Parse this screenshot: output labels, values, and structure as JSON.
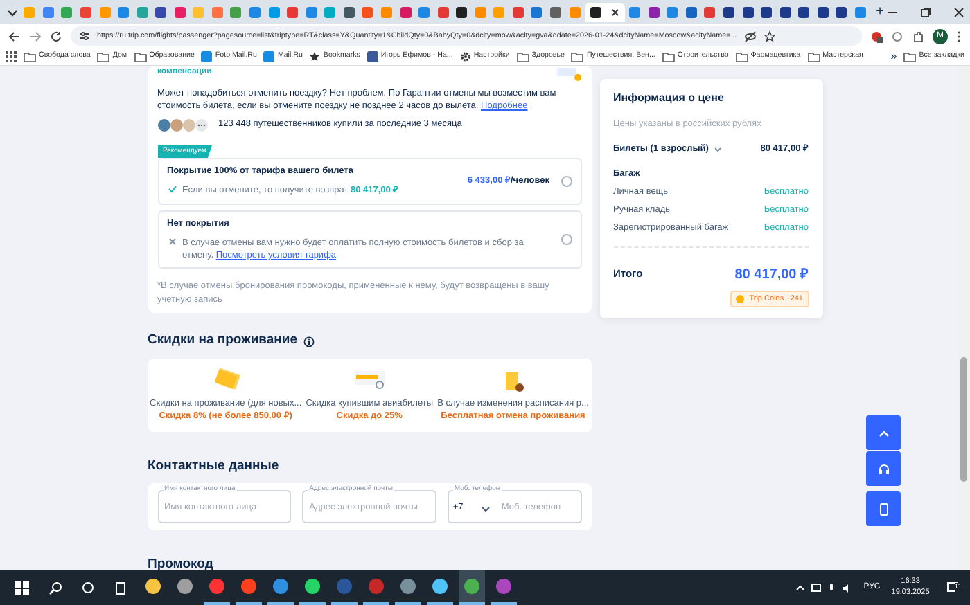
{
  "browser": {
    "tabs": [
      {
        "color": "#f9ab00",
        "selected": false
      },
      {
        "color": "#4285f4",
        "selected": false
      },
      {
        "color": "#34a853",
        "selected": false
      },
      {
        "color": "#ea4335",
        "selected": false
      },
      {
        "color": "#ff9800",
        "selected": false
      },
      {
        "color": "#1e88e5",
        "selected": false
      },
      {
        "color": "#26a69a",
        "selected": false
      },
      {
        "color": "#3949ab",
        "selected": false
      },
      {
        "color": "#e91e63",
        "selected": false
      },
      {
        "color": "#fbc02d",
        "selected": false
      },
      {
        "color": "#ff7043",
        "selected": false
      },
      {
        "color": "#43a047",
        "selected": false
      },
      {
        "color": "#1e88e5",
        "selected": false
      },
      {
        "color": "#039be5",
        "selected": false
      },
      {
        "color": "#e53935",
        "selected": false
      },
      {
        "color": "#1e88e5",
        "selected": false
      },
      {
        "color": "#00acc1",
        "selected": false
      },
      {
        "color": "#455a64",
        "selected": false
      },
      {
        "color": "#f4511e",
        "selected": false
      },
      {
        "color": "#fb8c00",
        "selected": false
      },
      {
        "color": "#d81b60",
        "selected": false
      },
      {
        "color": "#1e88e5",
        "selected": false
      },
      {
        "color": "#e53935",
        "selected": false
      },
      {
        "color": "#212121",
        "selected": false
      },
      {
        "color": "#fb8c00",
        "selected": false
      },
      {
        "color": "#ffa000",
        "selected": false
      },
      {
        "color": "#e53935",
        "selected": false
      },
      {
        "color": "#1976d2",
        "selected": false
      },
      {
        "color": "#616161",
        "selected": false
      },
      {
        "color": "#fb8c00",
        "selected": false
      },
      {
        "color": "#212121",
        "selected": true
      },
      {
        "color": "#1e88e5",
        "selected": false
      },
      {
        "color": "#8e24aa",
        "selected": false
      },
      {
        "color": "#1e88e5",
        "selected": false
      },
      {
        "color": "#1565c0",
        "selected": false
      },
      {
        "color": "#e53935",
        "selected": false
      },
      {
        "color": "#1e3a8a",
        "selected": false
      },
      {
        "color": "#1e3a8a",
        "selected": false
      },
      {
        "color": "#1e3a8a",
        "selected": false
      },
      {
        "color": "#1e3a8a",
        "selected": false
      },
      {
        "color": "#1e3a8a",
        "selected": false
      },
      {
        "color": "#1e3a8a",
        "selected": false
      },
      {
        "color": "#1e3a8a",
        "selected": false
      },
      {
        "color": "#1e88e5",
        "selected": false
      }
    ],
    "new_tab": "+",
    "url": "https://ru.trip.com/flights/passenger?pagesource=list&triptype=RT&class=Y&Quantity=1&ChildQty=0&BabyQty=0&dcity=mow&acity=gva&ddate=2026-01-24&dcityName=Moscow&acityName=...",
    "profile": "M",
    "bookmarks": [
      {
        "kind": "folder",
        "label": "Свобода слова"
      },
      {
        "kind": "folder",
        "label": "Дом"
      },
      {
        "kind": "folder",
        "label": "Образование"
      },
      {
        "kind": "site",
        "label": "Foto.Mail.Ru",
        "color": "#168de2"
      },
      {
        "kind": "site",
        "label": "Mail.Ru",
        "color": "#168de2"
      },
      {
        "kind": "star",
        "label": "Bookmarks"
      },
      {
        "kind": "site",
        "label": "Игорь Ефимов - На...",
        "color": "#3b5998"
      },
      {
        "kind": "gear",
        "label": "Настройки"
      },
      {
        "kind": "folder",
        "label": "Здоровье"
      },
      {
        "kind": "folder",
        "label": "Путешествия. Вен..."
      },
      {
        "kind": "folder",
        "label": "Строительство"
      },
      {
        "kind": "folder",
        "label": "Фармацевтика"
      },
      {
        "kind": "folder",
        "label": "Мастерская"
      }
    ],
    "bookmarks_overflow": "»",
    "all_bookmarks": "Все закладки"
  },
  "insurance": {
    "section_label": "компенсации",
    "description": "Может понадобиться отменить поездку? Нет проблем. По Гарантии отмены мы возместим вам стоимость билета, если вы отмените поездку не позднее 2 часов до вылета.",
    "more_link": "Подробнее",
    "travelers": "123 448 путешественников купили за последние 3 месяца",
    "options": [
      {
        "badge": "Рекомендуем",
        "title": "Покрытие 100% от тарифа вашего билета",
        "price": "6 433,00 ₽",
        "price_unit": "/человек",
        "kind": "covered",
        "note": "Если вы отмените, то получите возврат",
        "refund": "80 417,00 ₽",
        "selected": false
      },
      {
        "title": "Нет покрытия",
        "kind": "uncovered",
        "note": "В случае отмены вам нужно будет оплатить полную стоимость билетов и сбор за отмену.",
        "link": "Посмотреть условия тарифа",
        "selected": false
      }
    ],
    "footnote": "*В случае отмены бронирования промокоды, примененные к нему, будут возвращены в вашу учетную запись"
  },
  "price_info": {
    "title": "Информация о цене",
    "subtitle": "Цены указаны в российских рублях",
    "tickets_label": "Билеты (1 взрослый)",
    "tickets_price": "80 417,00 ₽",
    "baggage_title": "Багаж",
    "baggage": [
      {
        "label": "Личная вещь",
        "value": "Бесплатно"
      },
      {
        "label": "Ручная кладь",
        "value": "Бесплатно"
      },
      {
        "label": "Зарегистрированный багаж",
        "value": "Бесплатно"
      }
    ],
    "total_label": "Итого",
    "total": "80 417,00 ₽",
    "coins": "Trip Coins +241"
  },
  "stay_discounts": {
    "title": "Скидки на проживание",
    "items": [
      {
        "kind": "coupon",
        "title": "Скидки на проживание (для новых...",
        "offer": "Скидка 8% (не более 850,00 ₽)"
      },
      {
        "kind": "search",
        "title": "Скидка купившим авиабилеты",
        "offer": "Скидка до 25%"
      },
      {
        "kind": "hotel",
        "title": "В случае изменения расписания р...",
        "offer": "Бесплатная отмена проживания"
      }
    ]
  },
  "contacts": {
    "title": "Контактные данные",
    "fields": [
      {
        "kind": "text",
        "label": "Имя контактного лица",
        "placeholder": "Имя контактного лица"
      },
      {
        "kind": "text",
        "label": "Адрес электронной почты",
        "placeholder": "Адрес электронной почты"
      },
      {
        "kind": "phone",
        "label": "Моб. телефон",
        "code": "+7",
        "placeholder": "Моб. телефон"
      }
    ]
  },
  "promo": {
    "title": "Промокод"
  },
  "taskbar": {
    "apps": [
      {
        "color": "#f6c343",
        "running": false,
        "selected": false
      },
      {
        "color": "#9e9e9e",
        "running": false,
        "selected": false
      },
      {
        "color": "#ff3333",
        "running": true,
        "selected": false
      },
      {
        "color": "#fc3f1d",
        "running": true,
        "selected": false
      },
      {
        "color": "#2f8fe0",
        "running": true,
        "selected": false
      },
      {
        "color": "#25d366",
        "running": true,
        "selected": false
      },
      {
        "color": "#2b579a",
        "running": true,
        "selected": false
      },
      {
        "color": "#c62828",
        "running": true,
        "selected": false
      },
      {
        "color": "#78909c",
        "running": true,
        "selected": false
      },
      {
        "color": "#4fc3f7",
        "running": true,
        "selected": false
      },
      {
        "color": "#4caf50",
        "running": true,
        "selected": true
      },
      {
        "color": "#ab47bc",
        "running": true,
        "selected": false
      }
    ],
    "language": "РУС",
    "time": "16:33",
    "date": "19.03.2025",
    "notification_count": "11"
  }
}
